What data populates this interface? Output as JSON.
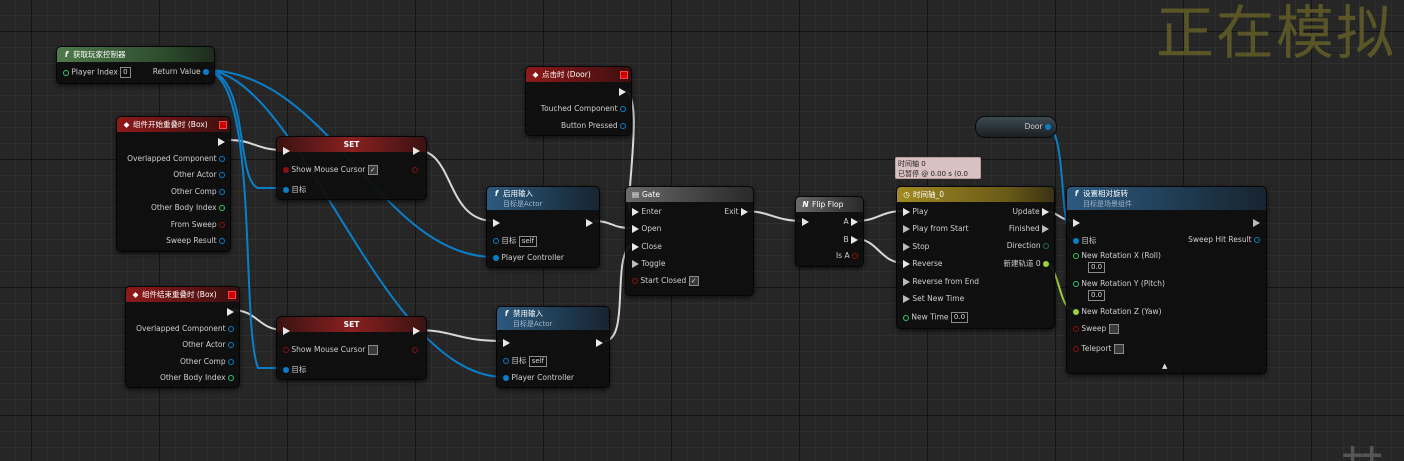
{
  "watermark": "正在模拟",
  "colors": {
    "exec": "#e8e8e8",
    "object": "#0a7fc9",
    "bool": "#8c1010",
    "float": "#9bd23d",
    "vector": "#37c56c"
  },
  "nodes": {
    "get_controller": {
      "title": "获取玩家控制器",
      "icon": "f",
      "pin_player_index": "Player Index",
      "player_index_value": "0",
      "pin_return_value": "Return Value"
    },
    "begin_overlap": {
      "title": "组件开始重叠时 (Box)",
      "pins": [
        "Overlapped Component",
        "Other Actor",
        "Other Comp",
        "Other Body Index",
        "From Sweep",
        "Sweep Result"
      ]
    },
    "end_overlap": {
      "title": "组件结束重叠时 (Box)",
      "pins": [
        "Overlapped Component",
        "Other Actor",
        "Other Comp",
        "Other Body Index"
      ]
    },
    "set1": {
      "title": "SET",
      "pin_show_cursor": "Show Mouse Cursor",
      "checked": "✓",
      "pin_target": "目标"
    },
    "set2": {
      "title": "SET",
      "pin_show_cursor": "Show Mouse Cursor",
      "checked": "",
      "pin_target": "目标"
    },
    "clicked_door": {
      "title": "点击时 (Door)",
      "pin_touched": "Touched Component",
      "pin_button": "Button Pressed"
    },
    "enable_input": {
      "title": "启用输入",
      "subtitle": "目标是Actor",
      "pin_target": "目标",
      "target_value": "self",
      "pin_controller": "Player Controller"
    },
    "disable_input": {
      "title": "禁用输入",
      "subtitle": "目标是Actor",
      "pin_target": "目标",
      "target_value": "self",
      "pin_controller": "Player Controller"
    },
    "gate": {
      "title": "Gate",
      "pin_enter": "Enter",
      "pin_exit": "Exit",
      "pin_open": "Open",
      "pin_close": "Close",
      "pin_toggle": "Toggle",
      "pin_start_closed": "Start Closed",
      "start_closed_checked": "✓"
    },
    "flipflop": {
      "title": "Flip Flop",
      "icon": "N",
      "pin_a": "A",
      "pin_b": "B",
      "pin_is_a": "Is A"
    },
    "timeline": {
      "title": "时间轴_0",
      "pin_play": "Play",
      "pin_play_start": "Play from Start",
      "pin_stop": "Stop",
      "pin_reverse": "Reverse",
      "pin_reverse_end": "Reverse from End",
      "pin_set_time": "Set New Time",
      "pin_new_time": "New Time",
      "new_time_value": "0.0",
      "pin_update": "Update",
      "pin_finished": "Finished",
      "pin_direction": "Direction",
      "pin_track": "新建轨道 0"
    },
    "timeline_tip": {
      "line1": "时间轴 0",
      "line2": "已暂停 @ 0.00 s (0.0 %)"
    },
    "door_var": {
      "label": "Door"
    },
    "set_rotation": {
      "title": "设置相对旋转",
      "subtitle": "目标是场景组件",
      "pin_target": "目标",
      "pin_sweep_result": "Sweep Hit Result",
      "pin_roll": "New Rotation X (Roll)",
      "roll_value": "0.0",
      "pin_pitch": "New Rotation Y (Pitch)",
      "pitch_value": "0.0",
      "pin_yaw": "New Rotation Z (Yaw)",
      "pin_sweep": "Sweep",
      "pin_teleport": "Teleport",
      "expand": "▲"
    }
  }
}
